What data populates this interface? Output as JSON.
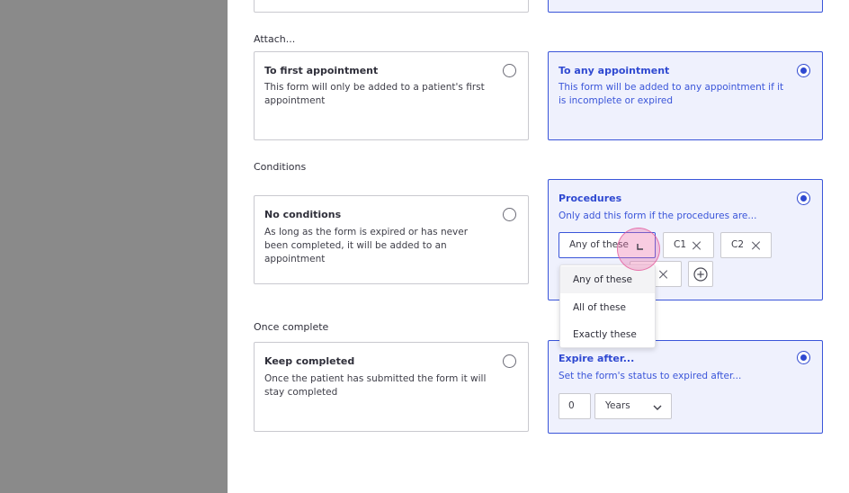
{
  "sections": {
    "attach": "Attach...",
    "conditions": "Conditions",
    "once_complete": "Once complete"
  },
  "attach": {
    "first": {
      "title": "To first appointment",
      "desc": "This form will only be added to a patient's first appointment",
      "selected": false
    },
    "any": {
      "title": "To any appointment",
      "desc": "This form will be added to any appointment if it is incomplete or expired",
      "selected": true
    }
  },
  "conditions": {
    "none": {
      "title": "No conditions",
      "desc": "As long as the form is expired or has never been completed, it will be added to an appointment",
      "selected": false
    },
    "procedures": {
      "title": "Procedures",
      "desc": "Only add this form if the procedures are...",
      "selected": true,
      "match_value": "Any of these",
      "tags": [
        "C1",
        "C2"
      ],
      "options": [
        "Any of these",
        "All of these",
        "Exactly these"
      ]
    }
  },
  "once_complete": {
    "keep": {
      "title": "Keep completed",
      "desc": "Once the patient has submitted the form it will stay completed",
      "selected": false
    },
    "expire": {
      "title": "Expire after...",
      "desc": "Set the form's status to expired after...",
      "selected": true,
      "amount": "0",
      "unit": "Years"
    }
  },
  "colors": {
    "accent": "#2f49d1",
    "selected_bg": "#eff1fd",
    "border": "#c9c9cf"
  }
}
